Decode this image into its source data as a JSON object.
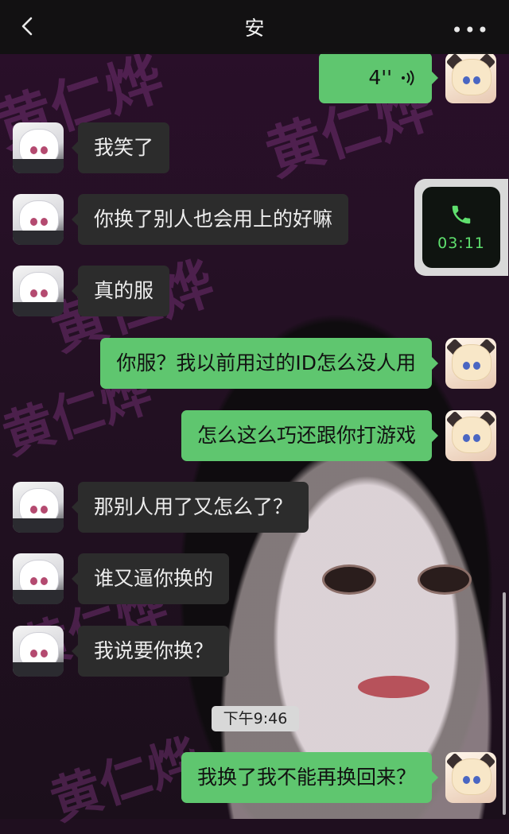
{
  "header": {
    "title": "安",
    "more": "•••"
  },
  "messages": [
    {
      "side": "right",
      "type": "voice",
      "duration": "4''"
    },
    {
      "side": "left",
      "text": "我笑了"
    },
    {
      "side": "left",
      "text": "你换了别人也会用上的好嘛"
    },
    {
      "side": "left",
      "text": "真的服"
    },
    {
      "side": "right",
      "text": "你服？我以前用过的ID怎么没人用"
    },
    {
      "side": "right",
      "text": "怎么这么巧还跟你打游戏"
    },
    {
      "side": "left",
      "text": "那别人用了又怎么了？"
    },
    {
      "side": "left",
      "text": "谁又逼你换的"
    },
    {
      "side": "left",
      "text": "我说要你换？"
    },
    {
      "side": "right",
      "text": "我换了我不能再换回来？"
    }
  ],
  "call": {
    "duration": "03:11"
  },
  "timestamp": "下午9:46",
  "wallpaper_text": "黄仁烨",
  "colors": {
    "sent_bubble": "#5fc66f",
    "received_bubble": "#2c2c2c",
    "call_green": "#5fe06e"
  }
}
